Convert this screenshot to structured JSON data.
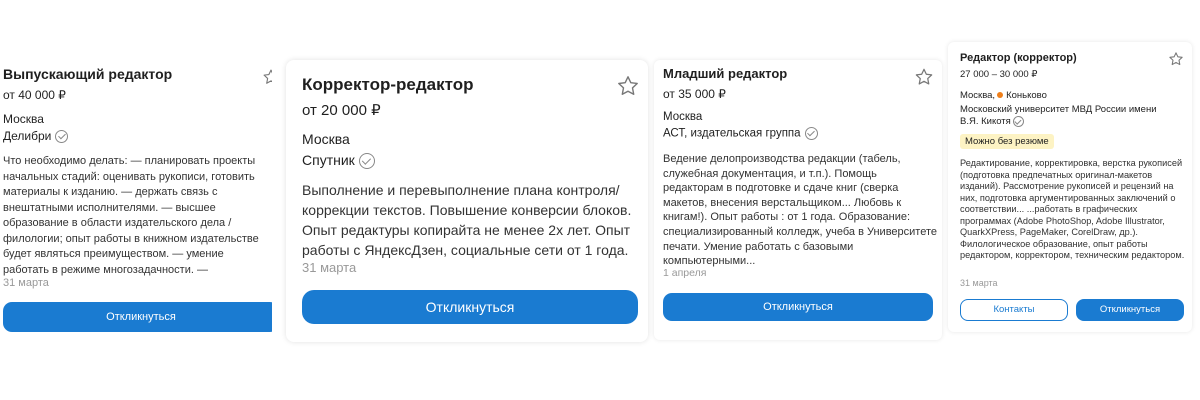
{
  "colors": {
    "accent": "#1a7bd1",
    "metro_orange": "#ef7f1a",
    "badge_bg": "#fdf3c4"
  },
  "cards": [
    {
      "title": "Выпускающий редактор",
      "salary": "от 40 000 ₽",
      "city": "Москва",
      "company": "Делибри",
      "desc": "Что необходимо делать: — планировать проекты начальных стадий: оценивать рукописи, готовить материалы к изданию. — держать связь с внештатными исполнителями. — высшее образование в области издательского дела / филологии; опыт работы в книжном издательстве будет являться преимуществом. — умение работать в режиме многозадачности. —",
      "date": "31 марта",
      "button": "Откликнуться"
    },
    {
      "title": "Корректор-редактор",
      "salary": "от 20 000 ₽",
      "city": "Москва",
      "company": "Спутник",
      "desc": "Выполнение и перевыполнение плана контроля/коррекции текстов. Повышение конверсии блоков. Опыт редактуры копирайта не менее 2х лет. Опыт работы с ЯндексДзен, социальные сети от 1 года.",
      "date": "31 марта",
      "button": "Откликнуться"
    },
    {
      "title": "Младший редактор",
      "salary": "от 35 000 ₽",
      "city": "Москва",
      "company": "АСТ, издательская группа",
      "desc": "Ведение делопроизводства редакции (табель, служебная документация, и т.п.). Помощь редакторам в подготовке и сдаче книг (сверка макетов, внесения верстальщиком... Любовь к книгам!). Опыт работы : от 1 года. Образование: специализированный колледж, учеба в Университете печати. Умение работать с базовыми компьютерными...",
      "date": "1 апреля",
      "button": "Откликнуться"
    },
    {
      "title": "Редактор (корректор)",
      "salary": "27 000 – 30 000 ₽",
      "city": "Москва,",
      "metro": "Коньково",
      "company": "Московский университет МВД России имени В.Я. Кикотя",
      "badge": "Можно без резюме",
      "desc": "Редактирование, корректировка, верстка рукописей (подготовка предпечатных оригинал-макетов изданий). Рассмотрение рукописей и рецензий на них, подготовка аргументированных заключений о соответствии... ...работать в графических программах (Adobe PhotoShop, Adobe Illustrator, QuarkXPress, PageMaker, CorelDraw, др.). Филологическое образование, опыт работы редактором, корректором, техническим редактором.",
      "date": "31 марта",
      "contacts_button": "Контакты",
      "button": "Откликнуться"
    }
  ]
}
